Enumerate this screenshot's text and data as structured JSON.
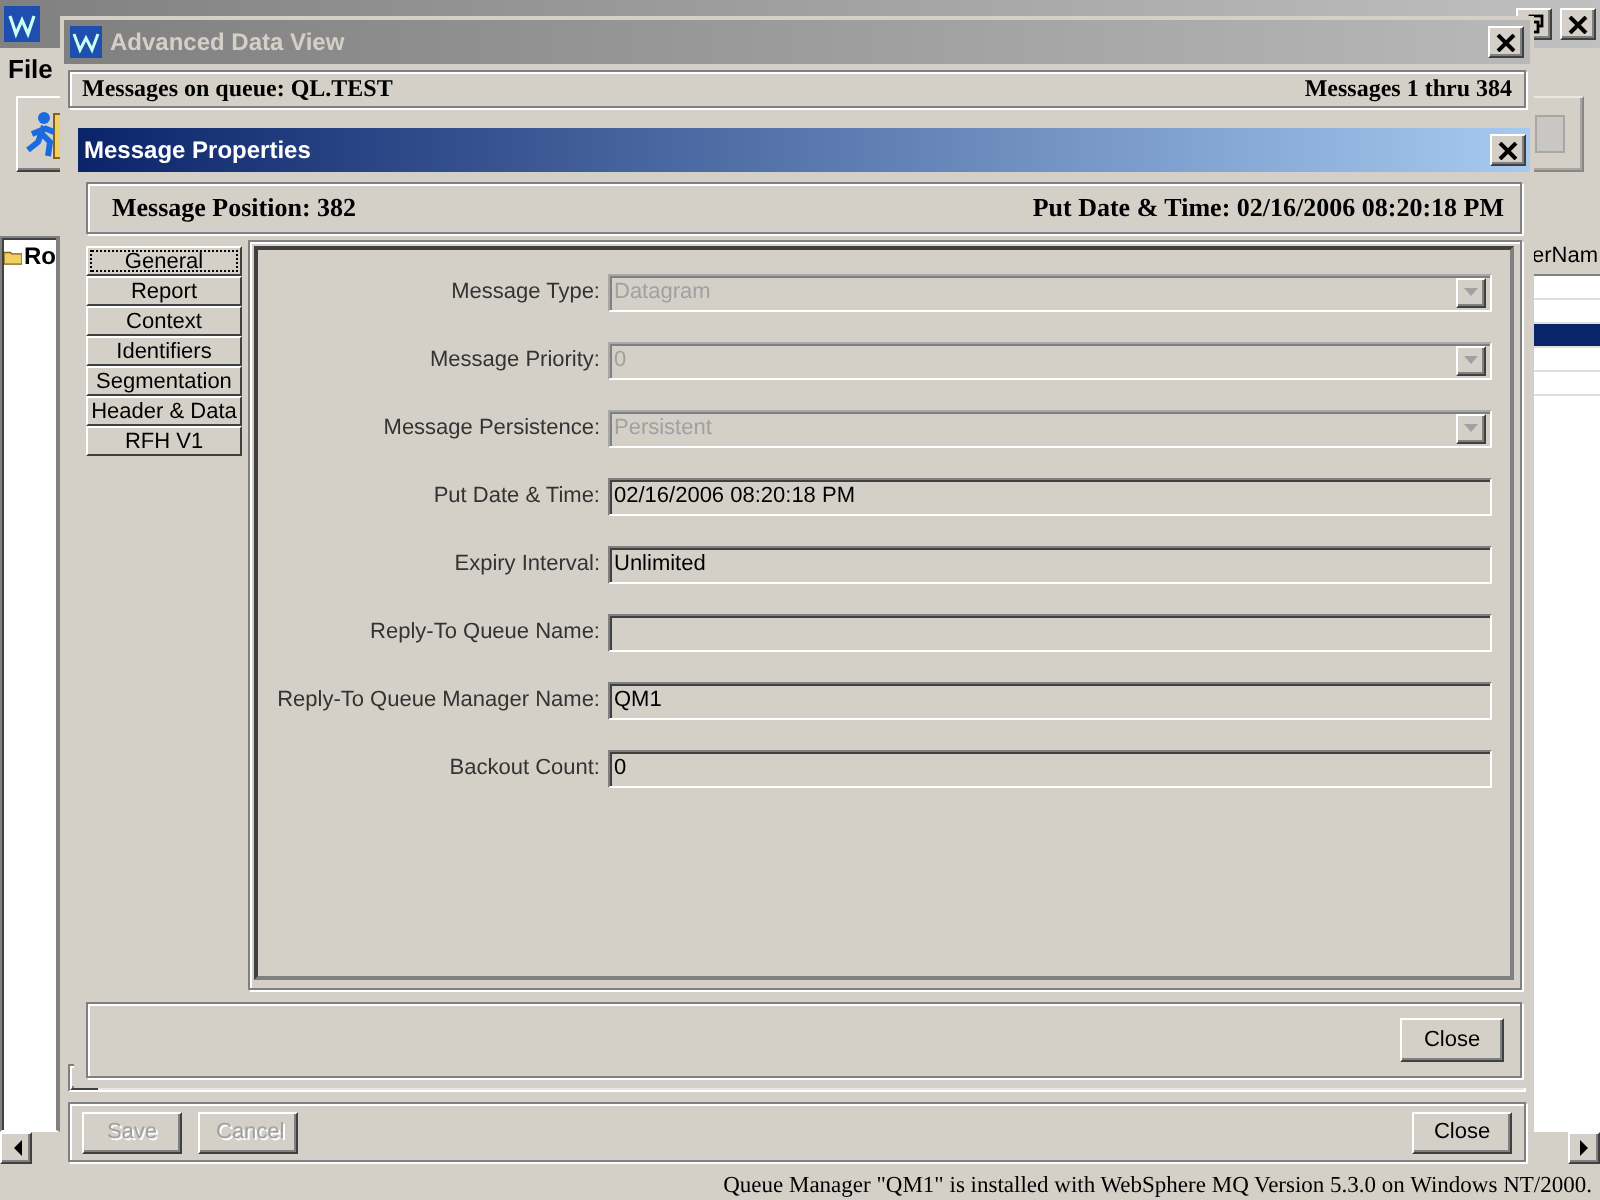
{
  "app_window": {
    "menu": [
      "File"
    ],
    "tree_items": [
      "Ro"
    ],
    "table_column_header": "erNam",
    "table_rows": [
      {
        "selected": false
      },
      {
        "selected": false
      },
      {
        "selected": true
      },
      {
        "selected": false
      },
      {
        "selected": false
      }
    ],
    "status_text": "Queue Manager \"QM1\" is installed with WebSphere MQ Version 5.3.0 on Windows NT/2000."
  },
  "advanced_window": {
    "title": "Advanced Data View",
    "queue_label": "Messages on queue: QL.TEST",
    "range_label": "Messages 1 thru 384",
    "buttons": [
      {
        "label": "Save",
        "disabled": true
      },
      {
        "label": "Cancel",
        "disabled": true
      },
      {
        "label": "Close",
        "disabled": false
      }
    ]
  },
  "dialog": {
    "title": "Message Properties",
    "position": "Message Position: 382",
    "put_date": "Put Date & Time: 02/16/2006 08:20:18 PM",
    "tabs": [
      {
        "label": "General",
        "selected": true
      },
      {
        "label": "Report",
        "selected": false
      },
      {
        "label": "Context",
        "selected": false
      },
      {
        "label": "Identifiers",
        "selected": false
      },
      {
        "label": "Segmentation",
        "selected": false
      },
      {
        "label": "Header & Data",
        "selected": false
      },
      {
        "label": "RFH V1",
        "selected": false
      }
    ],
    "fields": [
      {
        "label": "Message Type:",
        "kind": "dropdown",
        "value": "Datagram",
        "disabled": true
      },
      {
        "label": "Message Priority:",
        "kind": "dropdown",
        "value": "0",
        "disabled": true
      },
      {
        "label": "Message Persistence:",
        "kind": "dropdown",
        "value": "Persistent",
        "disabled": true
      },
      {
        "label": "Put Date & Time:",
        "kind": "text",
        "value": "02/16/2006 08:20:18 PM",
        "disabled": false
      },
      {
        "label": "Expiry Interval:",
        "kind": "text",
        "value": "Unlimited",
        "disabled": false
      },
      {
        "label": "Reply-To Queue Name:",
        "kind": "text",
        "disabled": false
      },
      {
        "label": "Reply-To Queue Manager Name:",
        "kind": "text",
        "value": "QM1",
        "disabled": false
      },
      {
        "label": "Backout Count:",
        "kind": "text",
        "value": "0",
        "disabled": false
      }
    ],
    "close_button": "Close"
  }
}
